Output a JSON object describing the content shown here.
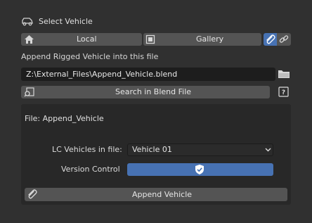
{
  "header": {
    "title": "Select Vehicle",
    "icon": "car-icon"
  },
  "source": {
    "local_label": "Local",
    "gallery_label": "Gallery",
    "local_icon": "home-icon",
    "gallery_icon": "image-icon",
    "append_icon": "paperclip-icon",
    "link_icon": "chain-link-icon",
    "active": "append"
  },
  "append_section": {
    "label": "Append Rigged Vehicle into this file"
  },
  "file_path": {
    "value": "Z:\\External_Files\\Append_Vehicle.blend",
    "browse_icon": "folder-icon"
  },
  "search": {
    "label": "Search in Blend File",
    "icon": "file-search-icon",
    "help_icon": "help-icon"
  },
  "panel": {
    "file_label": "File: Append_Vehicle",
    "lc_label": "LC Vehicles in file:",
    "selected_vehicle": "Vehicle 01",
    "version_label": "Version Control",
    "version_icon": "shield-check-icon",
    "append_button_label": "Append Vehicle"
  },
  "colors": {
    "background": "#303030",
    "panel": "#282828",
    "button": "#545454",
    "accent": "#4772b3",
    "field": "#1d1d1d"
  }
}
